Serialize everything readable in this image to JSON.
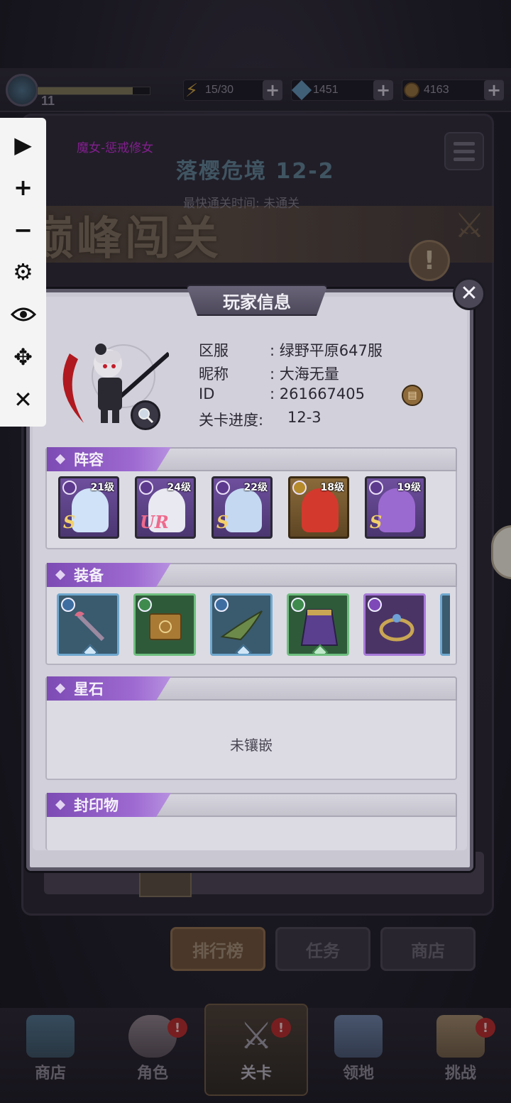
{
  "topbar": {
    "level": "11",
    "energy": "15/30",
    "gems": "1451",
    "coins": "4163"
  },
  "scene": {
    "boss_name": "魔女-惩戒修女",
    "stage_name": "落樱危境 12-2",
    "best_time": "最快通关时间:   未通关",
    "mode_title": "巅峰闯关",
    "buttons": [
      "排行榜",
      "任务",
      "商店"
    ]
  },
  "bottom_nav": [
    {
      "label": "商店",
      "badge": ""
    },
    {
      "label": "角色",
      "badge": "!"
    },
    {
      "label": "关卡",
      "badge": "!"
    },
    {
      "label": "领地",
      "badge": ""
    },
    {
      "label": "挑战",
      "badge": "!"
    }
  ],
  "toolbar": {
    "play": "▶",
    "zoom_in": "+",
    "zoom_out": "−",
    "settings": "⚙",
    "view": "👁",
    "move": "✥",
    "close": "✕"
  },
  "modal": {
    "title": "玩家信息",
    "close": "✕",
    "info": [
      {
        "label": "区服",
        "value": ": 绿野平原647服"
      },
      {
        "label": "昵称",
        "value": ": 大海无量"
      },
      {
        "label": "ID",
        "value": ": 261667405"
      },
      {
        "label": "关卡进度:",
        "value": "12-3"
      }
    ],
    "sections": {
      "lineup": "阵容",
      "equipment": "装备",
      "starstone": "星石",
      "seal": "封印物"
    },
    "starstone_empty": "未镶嵌",
    "heroes": [
      {
        "level": "21级",
        "rank": "S",
        "accent": "#8a4fc7",
        "hair": "#cfe2f7"
      },
      {
        "level": "24级",
        "rank": "UR",
        "accent": "#8a4fc7",
        "hair": "#e9e9f2"
      },
      {
        "level": "22级",
        "rank": "S",
        "accent": "#8a4fc7",
        "hair": "#c4d8f2"
      },
      {
        "level": "18级",
        "rank": "",
        "accent": "#d9a52a",
        "hair": "#d3392d"
      },
      {
        "level": "19级",
        "rank": "S",
        "accent": "#8a4fc7",
        "hair": "#9b6ad0"
      }
    ],
    "equipment": [
      {
        "name": "staff-icon",
        "frame": "#3d7aa8",
        "cls": "#3e6ea1"
      },
      {
        "name": "book-icon",
        "frame": "#3f8b4e",
        "cls": "#3f8b4e"
      },
      {
        "name": "hat-icon",
        "frame": "#3d7aa8",
        "cls": "#3e6ea1"
      },
      {
        "name": "skirt-icon",
        "frame": "#3f8b4e",
        "cls": "#3f8b4e"
      },
      {
        "name": "ring-icon",
        "frame": "#7e48b8",
        "cls": "#7e48b8"
      }
    ]
  }
}
